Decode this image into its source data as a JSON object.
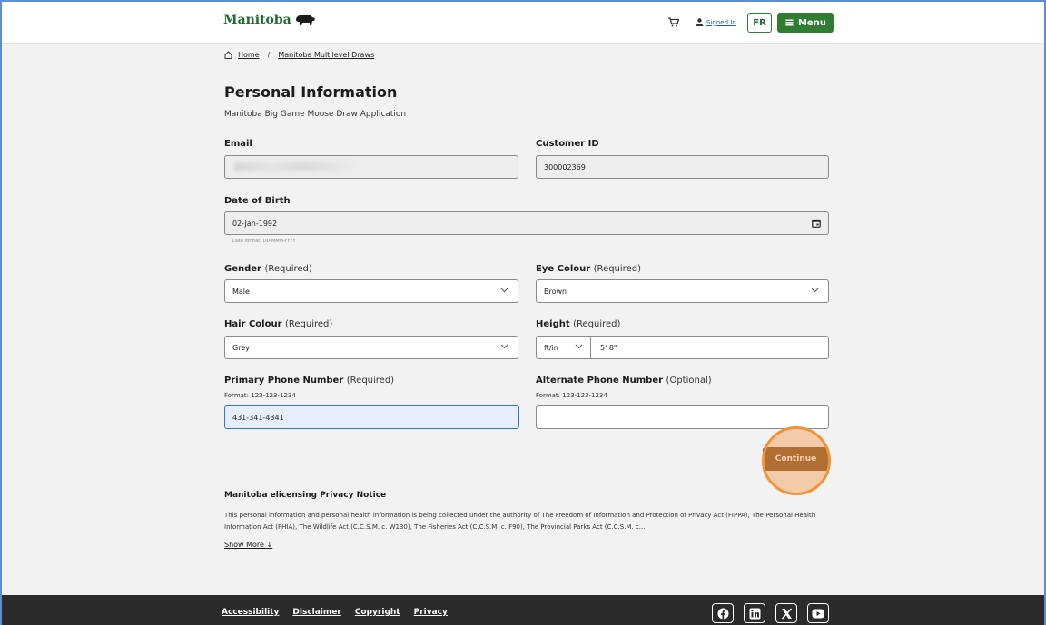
{
  "header": {
    "logo_text": "Manitoba",
    "signed_in_label": "Signed In",
    "lang_label": "FR",
    "menu_label": "Menu",
    "menu_icon": "≡"
  },
  "breadcrumb": {
    "home": "Home",
    "separator": "/",
    "current": "Manitoba Multilevel Draws"
  },
  "page": {
    "title": "Personal Information",
    "subtitle": "Manitoba Big Game Moose Draw Application"
  },
  "form": {
    "email": {
      "label": "Email",
      "value": ""
    },
    "customer_id": {
      "label": "Customer ID",
      "value": "300002369"
    },
    "dob": {
      "label": "Date of Birth",
      "value": "02-Jan-1992",
      "format": "Date format: DD-MMM-YYYY"
    },
    "gender": {
      "label": "Gender",
      "req": "(Required)",
      "value": "Male"
    },
    "eye_colour": {
      "label": "Eye Colour",
      "req": "(Required)",
      "value": "Brown"
    },
    "hair_colour": {
      "label": "Hair Colour",
      "req": "(Required)",
      "value": "Grey"
    },
    "height": {
      "label": "Height",
      "req": "(Required)",
      "unit": "ft/in",
      "value": "5' 8\""
    },
    "primary_phone": {
      "label": "Primary Phone Number",
      "req": "(Required)",
      "format": "Format: 123-123-1234",
      "value": "431-341-4341"
    },
    "alternate_phone": {
      "label": "Alternate Phone Number",
      "req": "(Optional)",
      "format": "Format: 123-123-1234",
      "value": ""
    },
    "continue_label": "Continue"
  },
  "privacy": {
    "title": "Manitoba elicensing Privacy Notice",
    "text": "This personal information and personal health information is being collected under the authority of The Freedom of Information and Protection of Privacy Act (FIPPA), The Personal Health Information Act (PHIA), The Wildlife Act (C.C.S.M. c. W130), The Fisheries Act (C.C.S.M. c. F90), The Provincial Parks Act (C.C.S.M. c...",
    "show_more": "Show More ↓"
  },
  "footer": {
    "links": [
      "Accessibility",
      "Disclaimer",
      "Copyright",
      "Privacy"
    ],
    "social_icons": [
      "facebook-icon",
      "linkedin-icon",
      "x-icon",
      "youtube-icon"
    ]
  },
  "colors": {
    "brand_green": "#2e7d32",
    "continue_brown": "#7a4a1b",
    "footer_bg": "#2b2b2b",
    "focus_blue": "#3b72c6"
  }
}
